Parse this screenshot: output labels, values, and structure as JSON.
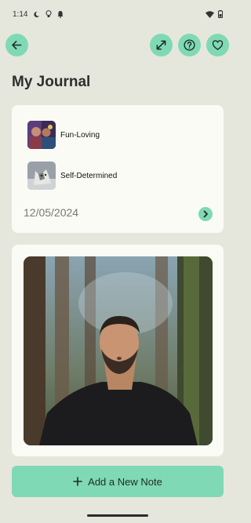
{
  "status_bar": {
    "time": "1:14",
    "icons": [
      "moon-icon",
      "lightbulb-icon",
      "bell-icon",
      "wifi-icon",
      "battery-icon"
    ]
  },
  "header": {
    "back_icon": "arrow-left-icon",
    "actions": [
      "expand-icon",
      "help-icon",
      "heart-icon"
    ]
  },
  "page_title": "My Journal",
  "traits_card": {
    "traits": [
      {
        "label": "Fun-Loving",
        "icon": "fun-loving-thumbnail"
      },
      {
        "label": "Self-Determined",
        "icon": "wolf-thumbnail"
      }
    ],
    "date": "12/05/2024"
  },
  "photo_card": {
    "image": "man-in-forest-photo"
  },
  "add_note": {
    "label": "Add a New Note",
    "icon": "plus-icon"
  },
  "colors": {
    "background": "#e5e7dc",
    "accent": "#7fd9b4",
    "card": "#fbfbf6"
  }
}
